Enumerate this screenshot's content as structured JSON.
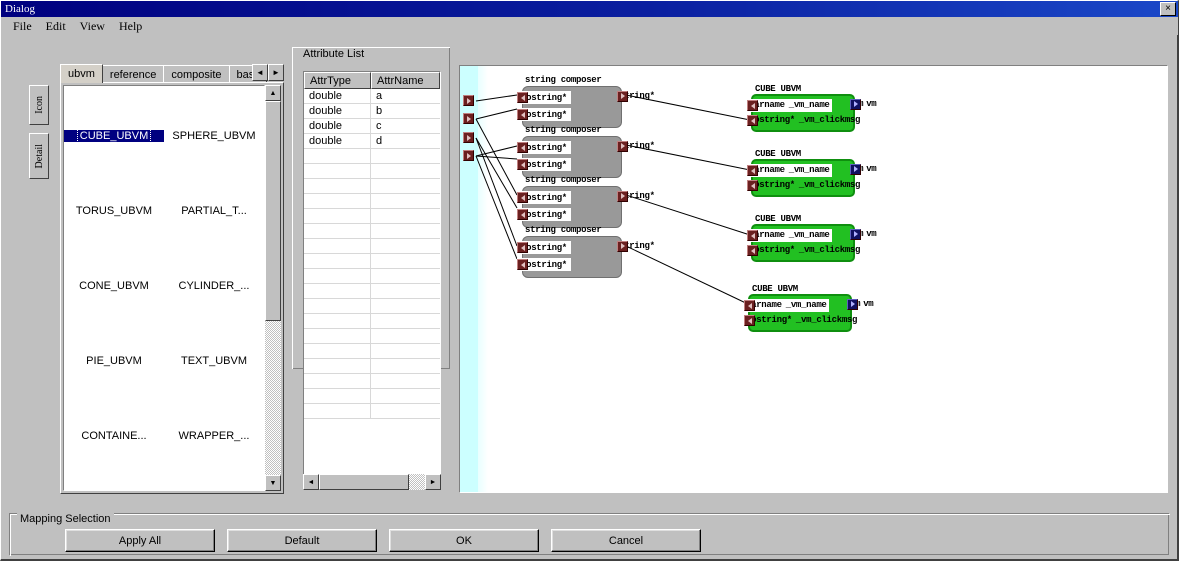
{
  "window": {
    "title": "Dialog",
    "close_label": "×"
  },
  "menu": {
    "items": [
      {
        "label": "File"
      },
      {
        "label": "Edit"
      },
      {
        "label": "View"
      },
      {
        "label": "Help"
      }
    ]
  },
  "side_tabs": {
    "items": [
      {
        "label": "Icon",
        "selected": true
      },
      {
        "label": "Detail",
        "selected": false
      }
    ]
  },
  "palette": {
    "tabs": [
      {
        "label": "ubvm",
        "active": true
      },
      {
        "label": "reference",
        "active": false
      },
      {
        "label": "composite",
        "active": false
      },
      {
        "label": "basic",
        "active": false
      }
    ],
    "scroll_left": "◄",
    "scroll_right": "►",
    "items": [
      {
        "label": "CUBE_UBVM",
        "selected": true
      },
      {
        "label": "SPHERE_UBVM",
        "selected": false
      },
      {
        "label": "TORUS_UBVM",
        "selected": false
      },
      {
        "label": "PARTIAL_T...",
        "selected": false
      },
      {
        "label": "CONE_UBVM",
        "selected": false
      },
      {
        "label": "CYLINDER_...",
        "selected": false
      },
      {
        "label": "PIE_UBVM",
        "selected": false
      },
      {
        "label": "TEXT_UBVM",
        "selected": false
      },
      {
        "label": "CONTAINE...",
        "selected": false
      },
      {
        "label": "WRAPPER_...",
        "selected": false
      }
    ],
    "scroll_up": "▲",
    "scroll_down": "▼"
  },
  "attribute_list": {
    "legend": "Attribute List",
    "columns": [
      "AttrType",
      "AttrName"
    ],
    "rows": [
      {
        "type": "double",
        "name": "a"
      },
      {
        "type": "double",
        "name": "b"
      },
      {
        "type": "double",
        "name": "c"
      },
      {
        "type": "double",
        "name": "d"
      }
    ],
    "empty_row_count": 18,
    "scroll_left": "◄",
    "scroll_right": "►"
  },
  "canvas": {
    "composer_nodes": [
      {
        "title": "string composer",
        "inputs": [
          "tostring*",
          "tostring*"
        ],
        "output": "string*"
      },
      {
        "title": "string composer",
        "inputs": [
          "tostring*",
          "tostring*"
        ],
        "output": "string*"
      },
      {
        "title": "string composer",
        "inputs": [
          "tostring*",
          "tostring*"
        ],
        "output": "string*"
      },
      {
        "title": "string composer",
        "inputs": [
          "tostring*",
          "tostring*"
        ],
        "output": "string*"
      }
    ],
    "ubvm_nodes": [
      {
        "title": "CUBE UBVM",
        "inputs": [
          {
            "type": "varname",
            "name": "_vm_name"
          },
          {
            "type": "tostring*",
            "name": "_vm_clickmsg"
          }
        ],
        "output": {
          "type": "vm",
          "name": "vm"
        }
      },
      {
        "title": "CUBE UBVM",
        "inputs": [
          {
            "type": "varname",
            "name": "_vm_name"
          },
          {
            "type": "tostring*",
            "name": "_vm_clickmsg"
          }
        ],
        "output": {
          "type": "vm",
          "name": "vm"
        }
      },
      {
        "title": "CUBE UBVM",
        "inputs": [
          {
            "type": "varname",
            "name": "_vm_name"
          },
          {
            "type": "tostring*",
            "name": "_vm_clickmsg"
          }
        ],
        "output": {
          "type": "vm",
          "name": "vm"
        }
      },
      {
        "title": "CUBE UBVM",
        "inputs": [
          {
            "type": "varname",
            "name": "_vm_name"
          },
          {
            "type": "tostring*",
            "name": "_vm_clickmsg"
          }
        ],
        "output": {
          "type": "vm",
          "name": "vm"
        }
      }
    ],
    "source_port_count": 4
  },
  "mapping_selection": {
    "legend": "Mapping Selection",
    "buttons": [
      {
        "label": "Apply All"
      },
      {
        "label": "Default"
      },
      {
        "label": "OK"
      },
      {
        "label": "Cancel"
      }
    ]
  },
  "colors": {
    "titlebar": "#000080",
    "face": "#c0c0c0",
    "selection": "#000080",
    "canvas_strip": "#ccffff",
    "composer_node": "#999999",
    "ubvm_node": "#22c022",
    "port_in": "#6b2020",
    "port_out": "#101060"
  }
}
